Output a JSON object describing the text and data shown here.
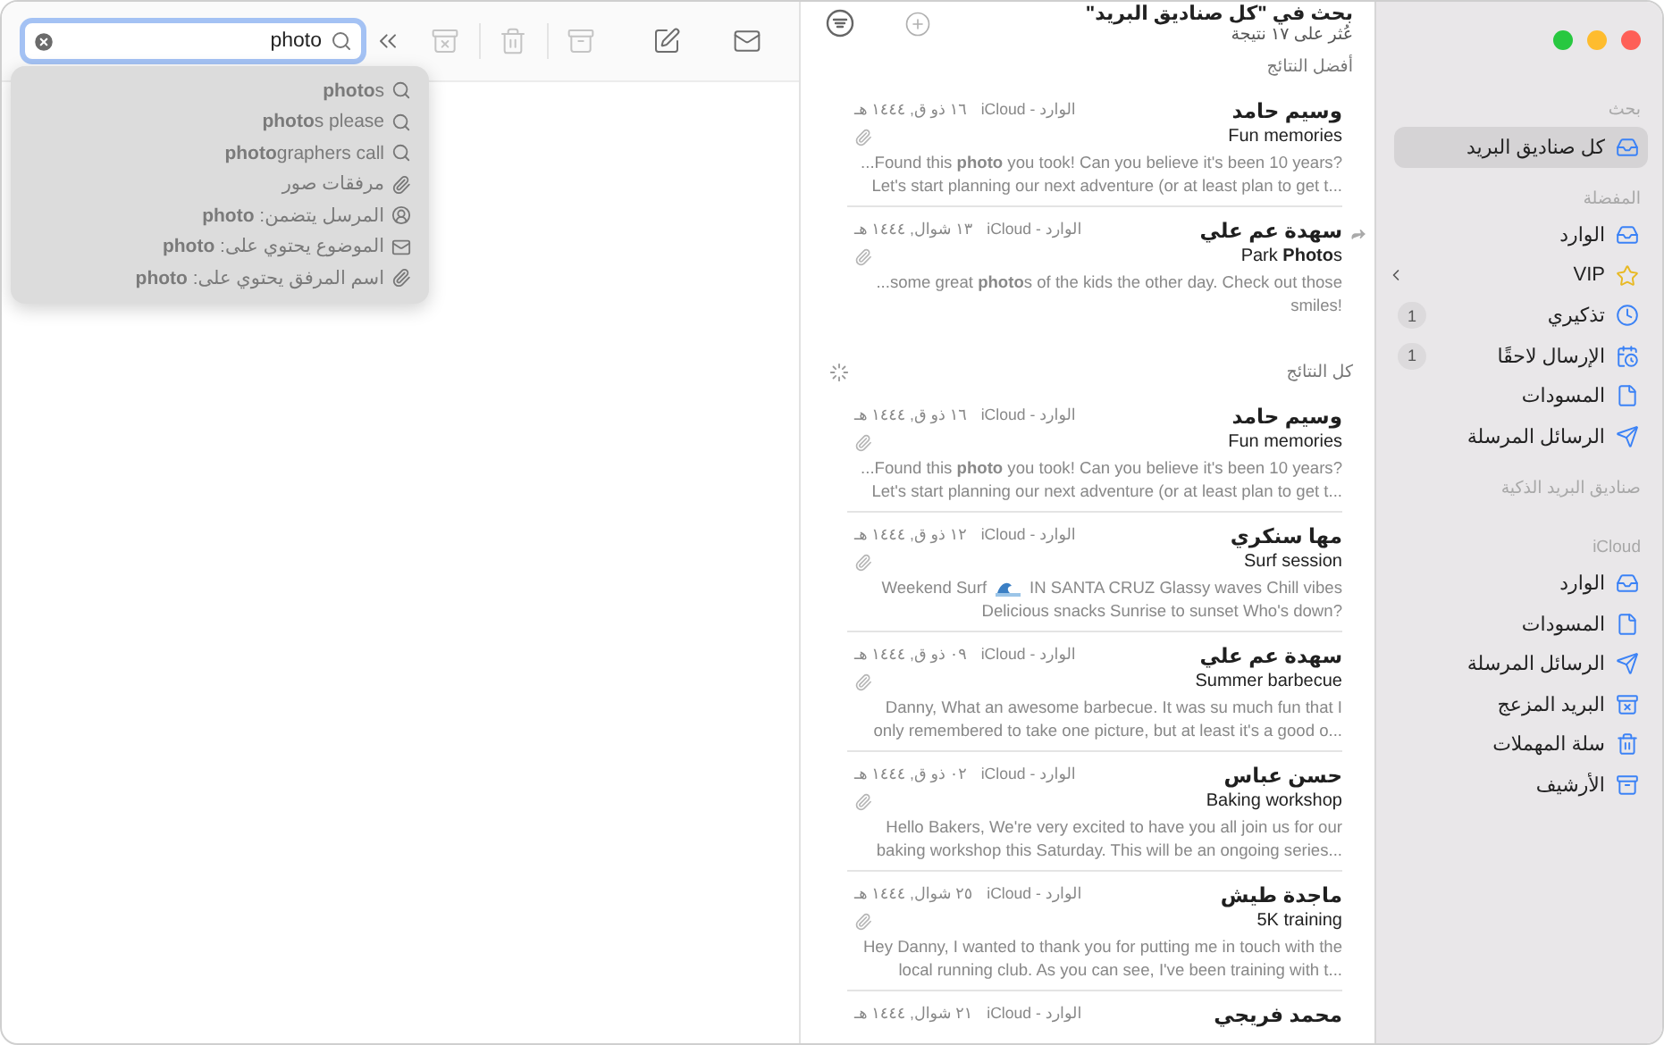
{
  "toolbar": {
    "search": {
      "value": "photo"
    },
    "buttons": [
      {
        "disabled": false
      },
      {
        "disabled": true
      },
      {
        "disabled": true
      },
      {
        "disabled": true
      },
      {
        "disabled": false
      },
      {
        "disabled": false
      }
    ]
  },
  "suggestions": [
    {
      "text": "**photo**s",
      "kind": "query"
    },
    {
      "text": "**photo**s please",
      "kind": "query"
    },
    {
      "text": "**photo**graphers call",
      "kind": "query"
    },
    {
      "text": "مرفقات صور",
      "kind": "attachment"
    },
    {
      "text": "المرسل يتضمن: **photo**",
      "kind": "sender"
    },
    {
      "text": "الموضوع يحتوي على: **photo**",
      "kind": "subject"
    },
    {
      "text": "اسم المرفق يحتوي على: **photo**",
      "kind": "attachment"
    }
  ],
  "list": {
    "title": "بحث في \"كل صناديق البريد\"",
    "subtitle": "عُثر على ١٧ نتيجة",
    "groups": [
      {
        "title": "أفضل النتائج",
        "loading": false,
        "messages": [
          {
            "sender": "وسيم حامد",
            "mailbox": "الوارد - iCloud",
            "date": "١٦ ذو ق, ١٤٤٤ هـ",
            "subject": "Fun memories",
            "preview": "...Found this **photo** you took! Can you believe it's been 10 years? Let's start planning our next adventure (or at least plan to get t...",
            "attachment": true,
            "replied": false
          },
          {
            "sender": "سهدة عم علي",
            "mailbox": "الوارد - iCloud",
            "date": "١٣ شوال, ١٤٤٤ هـ",
            "subject": "Park **Photo**s",
            "preview": "...some great **photo**s of the kids the other day. Check out those smiles!",
            "attachment": true,
            "replied": true
          }
        ]
      },
      {
        "title": "كل النتائج",
        "loading": true,
        "messages": [
          {
            "sender": "وسيم حامد",
            "mailbox": "الوارد - iCloud",
            "date": "١٦ ذو ق, ١٤٤٤ هـ",
            "subject": "Fun memories",
            "preview": "...Found this **photo** you took! Can you believe it's been 10 years? Let's start planning our next adventure (or at least plan to get t...",
            "attachment": true,
            "replied": false
          },
          {
            "sender": "مها سنكري",
            "mailbox": "الوارد - iCloud",
            "date": "١٢ ذو ق, ١٤٤٤ هـ",
            "subject": "Surf session",
            "preview_parts": [
              "Weekend Surf",
              "IN SANTA CRUZ Glassy waves Chill vibes",
              "Delicious snacks Sunrise to sunset Who's down?"
            ],
            "attachment": true,
            "replied": false
          },
          {
            "sender": "سهدة عم علي",
            "mailbox": "الوارد - iCloud",
            "date": "٠٩ ذو ق, ١٤٤٤ هـ",
            "subject": "Summer barbecue",
            "preview": "Danny, What an awesome barbecue. It was su much fun that I only remembered to take one picture, but at least it's a good o...",
            "attachment": true,
            "replied": false
          },
          {
            "sender": "حسن عباس",
            "mailbox": "الوارد - iCloud",
            "date": "٠٢ ذو ق, ١٤٤٤ هـ",
            "subject": "Baking workshop",
            "preview": "Hello Bakers, We're very excited to have you all join us for our baking workshop this Saturday. This will be an ongoing series...",
            "attachment": true,
            "replied": false
          },
          {
            "sender": "ماجدة طيش",
            "mailbox": "الوارد - iCloud",
            "date": "٢٥ شوال, ١٤٤٤ هـ",
            "subject": "5K training",
            "preview": "Hey Danny, I wanted to thank you for putting me in touch with the local running club. As you can see, I've been training with t...",
            "attachment": true,
            "replied": false
          },
          {
            "sender": "محمد فريجي",
            "mailbox": "الوارد - iCloud",
            "date": "٢١ شوال, ١٤٤٤ هـ"
          }
        ]
      }
    ]
  },
  "sidebar": {
    "sections": [
      {
        "title": "بحث",
        "items": [
          {
            "label": "كل صناديق البريد",
            "kind": "all",
            "selected": true
          }
        ]
      },
      {
        "title": "المفضلة",
        "items": [
          {
            "label": "الوارد",
            "kind": "inbox",
            "selected": false
          },
          {
            "label": "VIP",
            "kind": "vip",
            "selected": false
          },
          {
            "label": "تذكيري",
            "kind": "remind",
            "selected": false,
            "badge": "1"
          },
          {
            "label": "الإرسال لاحقًا",
            "kind": "later",
            "selected": false,
            "badge": "1"
          },
          {
            "label": "المسودات",
            "kind": "drafts",
            "selected": false
          },
          {
            "label": "الرسائل المرسلة",
            "kind": "sent",
            "selected": false
          }
        ]
      },
      {
        "title": "صناديق البريد الذكية"
      },
      {
        "title": "iCloud",
        "items": [
          {
            "label": "الوارد",
            "kind": "inbox",
            "selected": false
          },
          {
            "label": "المسودات",
            "kind": "drafts",
            "selected": false
          },
          {
            "label": "الرسائل المرسلة",
            "kind": "sent",
            "selected": false
          },
          {
            "label": "البريد المزعج",
            "kind": "junk",
            "selected": false
          },
          {
            "label": "سلة المهملات",
            "kind": "trash",
            "selected": false
          },
          {
            "label": "الأرشيف",
            "kind": "archive",
            "selected": false
          }
        ]
      }
    ]
  }
}
